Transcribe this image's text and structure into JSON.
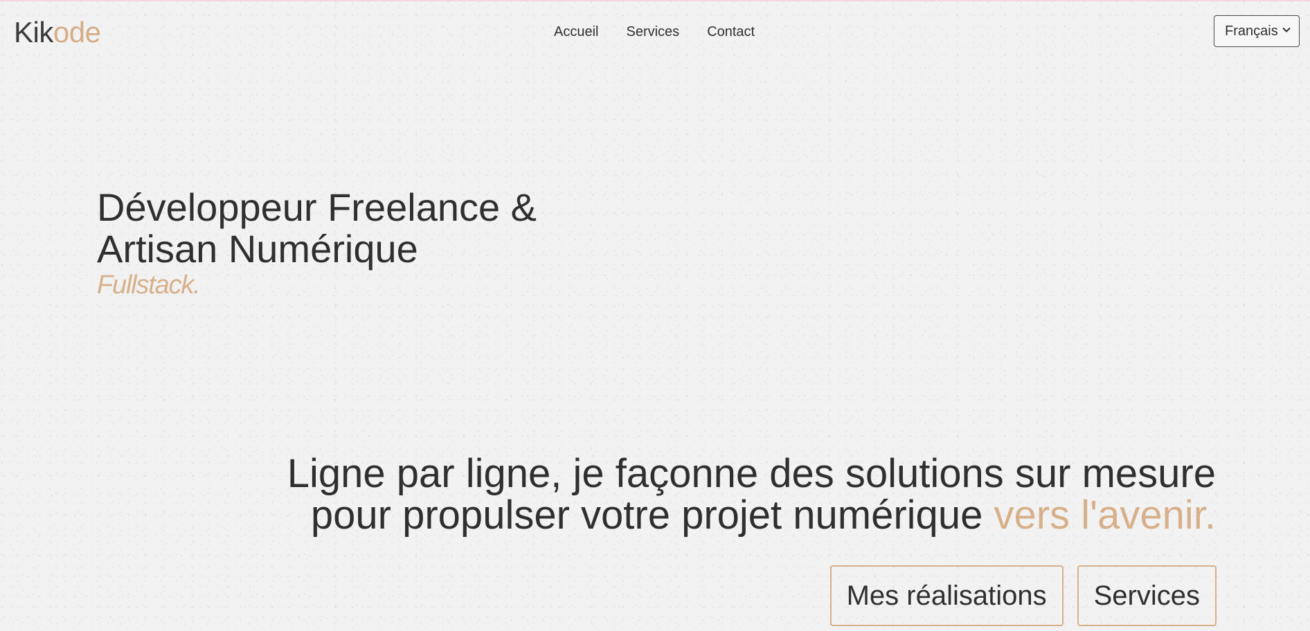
{
  "header": {
    "logo_part1": "Kik",
    "logo_part2": "ode",
    "nav": {
      "home": "Accueil",
      "services": "Services",
      "contact": "Contact"
    },
    "language": {
      "selected": "Français",
      "icon": "chevron-down-icon"
    }
  },
  "hero": {
    "title_line1": "Développeur Freelance &",
    "title_line2": "Artisan Numérique",
    "subtitle": "Fullstack."
  },
  "tagline": {
    "line1": "Ligne par ligne, je façonne des solutions sur mesure",
    "line2_prefix": "pour propulser votre projet numérique",
    "line2_accent": "vers l'avenir."
  },
  "actions": {
    "primary": "Mes réalisations",
    "secondary": "Services"
  },
  "colors": {
    "accent": "#d7b08a",
    "text": "#2f2f2f"
  }
}
